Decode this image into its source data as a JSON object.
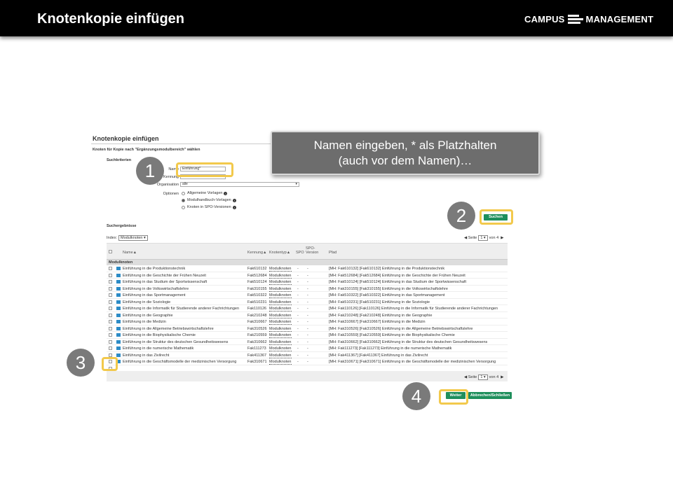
{
  "header": {
    "title": "Knotenkopie einfügen",
    "logo_left": "CAMPUS",
    "logo_right": "MANAGEMENT"
  },
  "screenshot": {
    "heading": "Knotenkopie einfügen",
    "subheading": "Knoten für Kopie nach \"Ergänzungsmodulbereich\" wählen",
    "criteria_title": "Suchkriterien",
    "name_label": "Name",
    "name_value": "Einführung*",
    "kennung_label": "Kennung",
    "org_label": "Organisation",
    "org_value": "alle",
    "options_label": "Optionen",
    "options": [
      {
        "label": "Allgemeine Vorlagen",
        "selected": false
      },
      {
        "label": "Modulhandbuch-Vorlagen",
        "selected": true
      },
      {
        "label": "Knoten in SPO-Versionen",
        "selected": false
      }
    ],
    "search_button": "Suchen",
    "results_title": "Suchergebnisse",
    "index_label": "Index:",
    "index_value": "Modulknoten",
    "pager": {
      "page_label": "Seite",
      "page_value": "1",
      "of_label": "von 4"
    },
    "columns": {
      "name": "Name▲",
      "kennung": "Kennung▲",
      "knotentyp": "Knotentyp▲",
      "spo": "SPO",
      "spo_version": "SPO-Version",
      "pfad": "Pfad"
    },
    "group": "Modulknoten",
    "rows": [
      {
        "name": "Einführung in die Produktionstechnik",
        "kennung": "Fak610132",
        "typ": "Modulknoten",
        "spo": "-",
        "ver": "-",
        "pfad": "[MH: Fak610132] [Fak610132] Einführung in die Produktionstechnik"
      },
      {
        "name": "Einführung in die Geschichte der Frühen Neuzeit",
        "kennung": "Fak512684",
        "typ": "Modulknoten",
        "spo": "-",
        "ver": "-",
        "pfad": "[MH: Fak512684] [Fak512684] Einführung in die Geschichte der Frühen Neuzeit"
      },
      {
        "name": "Einführung in das Studium der Sportwissenschaft",
        "kennung": "Fak510124",
        "typ": "Modulknoten",
        "spo": "-",
        "ver": "-",
        "pfad": "[MH: Fak510124] [Fak510124] Einführung in das Studium der Sportwissenschaft"
      },
      {
        "name": "Einführung in die Volkswirtschaftslehre",
        "kennung": "Fak310155",
        "typ": "Modulknoten",
        "spo": "-",
        "ver": "-",
        "pfad": "[MH: Fak310155] [Fak310155] Einführung in die Volkswirtschaftslehre"
      },
      {
        "name": "Einführung in das Sportmanagement",
        "kennung": "Fak510322",
        "typ": "Modulknoten",
        "spo": "-",
        "ver": "-",
        "pfad": "[MH: Fak510322] [Fak510322] Einführung in das Sportmanagement"
      },
      {
        "name": "Einführung in die Soziologie",
        "kennung": "Fak510231",
        "typ": "Modulknoten",
        "spo": "-",
        "ver": "-",
        "pfad": "[MH: Fak510231] [Fak510231] Einführung in die Soziologie"
      },
      {
        "name": "Einführung in die Informatik für Studierende anderer Fachrichtungen",
        "kennung": "Fak110126",
        "typ": "Modulknoten",
        "spo": "-",
        "ver": "-",
        "pfad": "[MH: Fak110126] [Fak110126] Einführung in die Informatik für Studierende anderer Fachrichtungen"
      },
      {
        "name": "Einführung in die Geographie",
        "kennung": "Fak210248",
        "typ": "Modulknoten",
        "spo": "-",
        "ver": "-",
        "pfad": "[MH: Fak210248] [Fak210248] Einführung in die Geographie"
      },
      {
        "name": "Einführung in die Medizin",
        "kennung": "Fak310667",
        "typ": "Modulknoten",
        "spo": "-",
        "ver": "-",
        "pfad": "[MH: Fak310667] [Fak310667] Einführung in die Medizin"
      },
      {
        "name": "Einführung in die Allgemeine Betriebswirtschaftslehre",
        "kennung": "Fak310526",
        "typ": "Modulknoten",
        "spo": "-",
        "ver": "-",
        "pfad": "[MH: Fak310526] [Fak310526] Einführung in die Allgemeine Betriebswirtschaftslehre"
      },
      {
        "name": "Einführung in die Biophysikalische Chemie",
        "kennung": "Fak210559",
        "typ": "Modulknoten",
        "spo": "-",
        "ver": "-",
        "pfad": "[MH: Fak210559] [Fak210559] Einführung in die Biophysikalische Chemie"
      },
      {
        "name": "Einführung in die Struktur des deutschen Gesundheitswesens",
        "kennung": "Fak310662",
        "typ": "Modulknoten",
        "spo": "-",
        "ver": "-",
        "pfad": "[MH: Fak310662] [Fak310662] Einführung in die Struktur des deutschen Gesundheitswesens"
      },
      {
        "name": "Einführung in die numerische Mathematik",
        "kennung": "Fak111273",
        "typ": "Modulknoten",
        "spo": "-",
        "ver": "-",
        "pfad": "[MH: Fak111273] [Fak111273] Einführung in die numerische Mathematik"
      },
      {
        "name": "Einführung in das Zivilrecht",
        "kennung": "Fak411367",
        "typ": "Modulknoten",
        "spo": "-",
        "ver": "-",
        "pfad": "[MH: Fak411367] [Fak411367] Einführung in das Zivilrecht"
      },
      {
        "name": "Einführung in die Geschäftsmodelle der medizinischen Versorgung",
        "kennung": "Fak310671",
        "typ": "Modulknoten",
        "spo": "-",
        "ver": "-",
        "pfad": "[MH: Fak310671] [Fak310671] Einführung in die Geschäftsmodelle der medizinischen Versorgung"
      }
    ],
    "next_button": "Weiter",
    "cancel_button": "Abbrechen/Schließen"
  },
  "tooltip": {
    "line1": "Namen eingeben, * als Platzhalten",
    "line2": "(auch vor dem Namen)…"
  },
  "badges": [
    "1",
    "2",
    "3",
    "4"
  ],
  "colors": {
    "highlight": "#f2c94c",
    "badge": "#7a7a7a",
    "button": "#1f8f5c",
    "node_icon": "#2c8bc6"
  }
}
